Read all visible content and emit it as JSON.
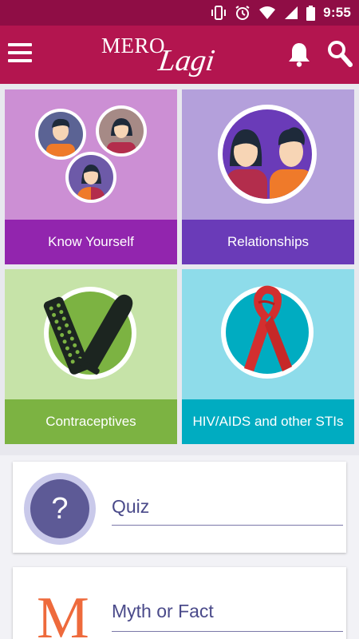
{
  "status_bar": {
    "time": "9:55",
    "icons": [
      "vibrate-icon",
      "alarm-icon",
      "wifi-icon",
      "signal-icon",
      "battery-icon"
    ]
  },
  "app_bar": {
    "logo_word1": "MERO",
    "logo_word2": "Lagi",
    "icons": [
      "hamburger-menu-icon",
      "bell-icon",
      "search-icon"
    ]
  },
  "tiles": [
    {
      "label": "Know Yourself",
      "caption_color": "#9225ae"
    },
    {
      "label": "Relationships",
      "caption_color": "#6a3bb8"
    },
    {
      "label": "Contraceptives",
      "caption_color": "#7cb342"
    },
    {
      "label": "HIV/AIDS and other STIs",
      "caption_color": "#00acc1"
    }
  ],
  "quiz": {
    "icon_glyph": "?",
    "label": "Quiz"
  },
  "myth": {
    "icon_glyph": "M",
    "label": "Myth or Fact"
  },
  "colors": {
    "status_bar": "#8f0d45",
    "app_bar": "#b3154f",
    "accent_text": "#4a4a8a"
  }
}
